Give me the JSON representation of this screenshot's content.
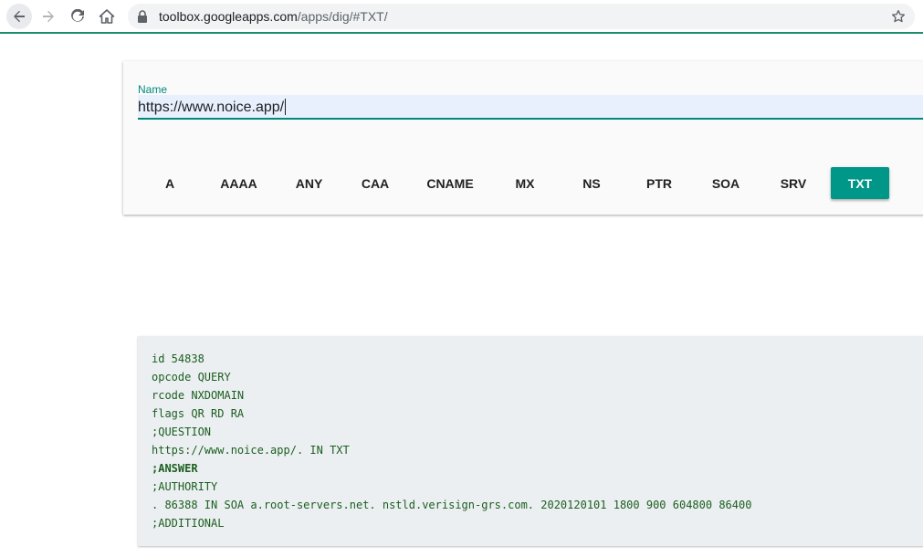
{
  "browser": {
    "url_host": "toolbox.googleapps.com",
    "url_path": "/apps/dig/#TXT/"
  },
  "query": {
    "name_label": "Name",
    "name_value": "https://www.noice.app/"
  },
  "record_types": [
    {
      "label": "A",
      "active": false
    },
    {
      "label": "AAAA",
      "active": false
    },
    {
      "label": "ANY",
      "active": false
    },
    {
      "label": "CAA",
      "active": false
    },
    {
      "label": "CNAME",
      "active": false
    },
    {
      "label": "MX",
      "active": false
    },
    {
      "label": "NS",
      "active": false
    },
    {
      "label": "PTR",
      "active": false
    },
    {
      "label": "SOA",
      "active": false
    },
    {
      "label": "SRV",
      "active": false
    },
    {
      "label": "TXT",
      "active": true
    }
  ],
  "result": {
    "lines": [
      "id 54838",
      "opcode QUERY",
      "rcode NXDOMAIN",
      "flags QR RD RA",
      ";QUESTION",
      "https://www.noice.app/. IN TXT",
      ";ANSWER",
      ";AUTHORITY",
      ". 86388 IN SOA a.root-servers.net. nstld.verisign-grs.com. 2020120101 1800 900 604800 86400",
      ";ADDITIONAL"
    ]
  },
  "colors": {
    "accent": "#009688",
    "result_text": "#1b5e20",
    "result_bg": "#eceff1"
  }
}
